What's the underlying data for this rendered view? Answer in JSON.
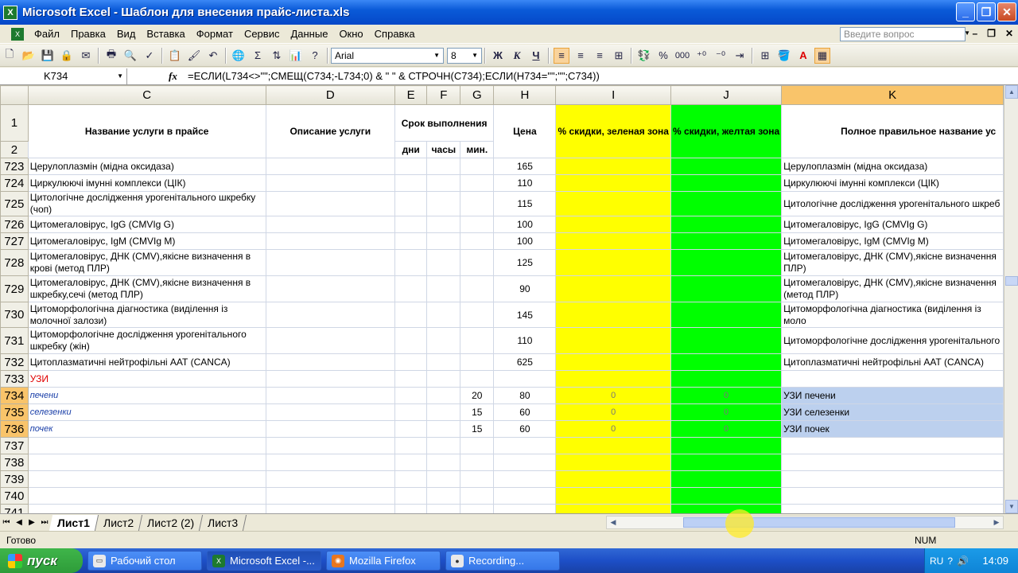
{
  "window": {
    "title": "Microsoft Excel - Шаблон для внесения прайс-листа.xls"
  },
  "menu": [
    "Файл",
    "Правка",
    "Вид",
    "Вставка",
    "Формат",
    "Сервис",
    "Данные",
    "Окно",
    "Справка"
  ],
  "ask_placeholder": "Введите вопрос",
  "toolbar": {
    "font": "Arial",
    "size": "8",
    "bold": "Ж",
    "italic": "К",
    "underline": "Ч",
    "percent": "%",
    "thousands": "000"
  },
  "formula_bar": {
    "name_box": "K734",
    "fx": "fx",
    "formula": "=ЕСЛИ(L734<>\"\";СМЕЩ(C734;-L734;0) & \" \" & СТРОЧН(C734);ЕСЛИ(H734=\"\";\"\";C734))"
  },
  "columns": [
    "C",
    "D",
    "E",
    "F",
    "G",
    "H",
    "I",
    "J",
    "K"
  ],
  "headers": {
    "service_name": "Название услуги в прайсе",
    "description": "Описание услуги",
    "duration": "Срок выполнения",
    "days": "дни",
    "hours": "часы",
    "minutes": "мин.",
    "price": "Цена",
    "discount_green": "% скидки, зеленая зона",
    "discount_yellow": "% скидки, желтая зона",
    "full_name": "Полное правильное название ус"
  },
  "header_rows": [
    "1",
    "2"
  ],
  "rows": [
    {
      "n": "723",
      "c": "Церулоплазмін (мідна оксидаза)",
      "g": "",
      "h": "165",
      "i": "",
      "j": "",
      "k": "Церулоплазмін (мідна оксидаза)"
    },
    {
      "n": "724",
      "c": "Циркулюючі імунні комплекси (ЦІК)",
      "g": "",
      "h": "110",
      "i": "",
      "j": "",
      "k": "Циркулюючі імунні комплекси (ЦІК)"
    },
    {
      "n": "725",
      "c": "Цитологічне дослідження урогенітального шкребку (чоп)",
      "g": "",
      "h": "115",
      "i": "",
      "j": "",
      "k": "Цитологічне дослідження урогенітального шкреб"
    },
    {
      "n": "726",
      "c": "Цитомегаловірус, IgG (CMVIg G)",
      "g": "",
      "h": "100",
      "i": "",
      "j": "",
      "k": "Цитомегаловірус, IgG (CMVIg G)"
    },
    {
      "n": "727",
      "c": "Цитомегаловірус, IgM (CMVIg M)",
      "g": "",
      "h": "100",
      "i": "",
      "j": "",
      "k": "Цитомегаловірус, IgM (CMVIg M)"
    },
    {
      "n": "728",
      "c": "Цитомегаловірус, ДНК (CMV),якісне визначення в крові (метод ПЛР)",
      "g": "",
      "h": "125",
      "i": "",
      "j": "",
      "k": "Цитомегаловірус, ДНК (CMV),якісне визначення ПЛР)"
    },
    {
      "n": "729",
      "c": "Цитомегаловірус, ДНК (CMV),якісне визначення в шкребку,сечі (метод ПЛР)",
      "g": "",
      "h": "90",
      "i": "",
      "j": "",
      "k": "Цитомегаловірус, ДНК (CMV),якісне визначення (метод ПЛР)"
    },
    {
      "n": "730",
      "c": "Цитоморфологічна діагностика (виділення із молочної залози)",
      "g": "",
      "h": "145",
      "i": "",
      "j": "",
      "k": "Цитоморфологічна діагностика (виділення із моло"
    },
    {
      "n": "731",
      "c": "Цитоморфологічне дослідження урогенітального шкребку (жін)",
      "g": "",
      "h": "110",
      "i": "",
      "j": "",
      "k": "Цитоморфологічне дослідження урогенітального"
    },
    {
      "n": "732",
      "c": "Цитоплазматичні нейтрофільні ААТ (CANCA)",
      "g": "",
      "h": "625",
      "i": "",
      "j": "",
      "k": "Цитоплазматичні нейтрофільні ААТ (CANCA)"
    },
    {
      "n": "733",
      "c": "УЗИ",
      "g": "",
      "h": "",
      "i": "",
      "j": "",
      "k": ""
    },
    {
      "n": "734",
      "c": "печени",
      "g": "20",
      "h": "80",
      "i": "0",
      "j": "0",
      "k": "УЗИ печени"
    },
    {
      "n": "735",
      "c": "селезенки",
      "g": "15",
      "h": "60",
      "i": "0",
      "j": "0",
      "k": "УЗИ селезенки"
    },
    {
      "n": "736",
      "c": "почек",
      "g": "15",
      "h": "60",
      "i": "0",
      "j": "0",
      "k": "УЗИ почек"
    },
    {
      "n": "737",
      "c": "",
      "g": "",
      "h": "",
      "i": "",
      "j": "",
      "k": ""
    },
    {
      "n": "738",
      "c": "",
      "g": "",
      "h": "",
      "i": "",
      "j": "",
      "k": ""
    },
    {
      "n": "739",
      "c": "",
      "g": "",
      "h": "",
      "i": "",
      "j": "",
      "k": ""
    },
    {
      "n": "740",
      "c": "",
      "g": "",
      "h": "",
      "i": "",
      "j": "",
      "k": ""
    },
    {
      "n": "741",
      "c": "",
      "g": "",
      "h": "",
      "i": "",
      "j": "",
      "k": ""
    }
  ],
  "sheet_tabs": [
    "Лист1",
    "Лист2",
    "Лист2 (2)",
    "Лист3"
  ],
  "status": {
    "ready": "Готово",
    "num": "NUM"
  },
  "taskbar": {
    "start": "пуск",
    "tasks": [
      "Рабочий стол",
      "Microsoft Excel -...",
      "Mozilla Firefox",
      "Recording..."
    ],
    "lang": "RU",
    "clock": "14:09"
  },
  "colors": {
    "yellow_zone": "#ffff00",
    "green_zone": "#00ff00",
    "selected_header": "#f9c46a",
    "category_text": "#e00000"
  }
}
